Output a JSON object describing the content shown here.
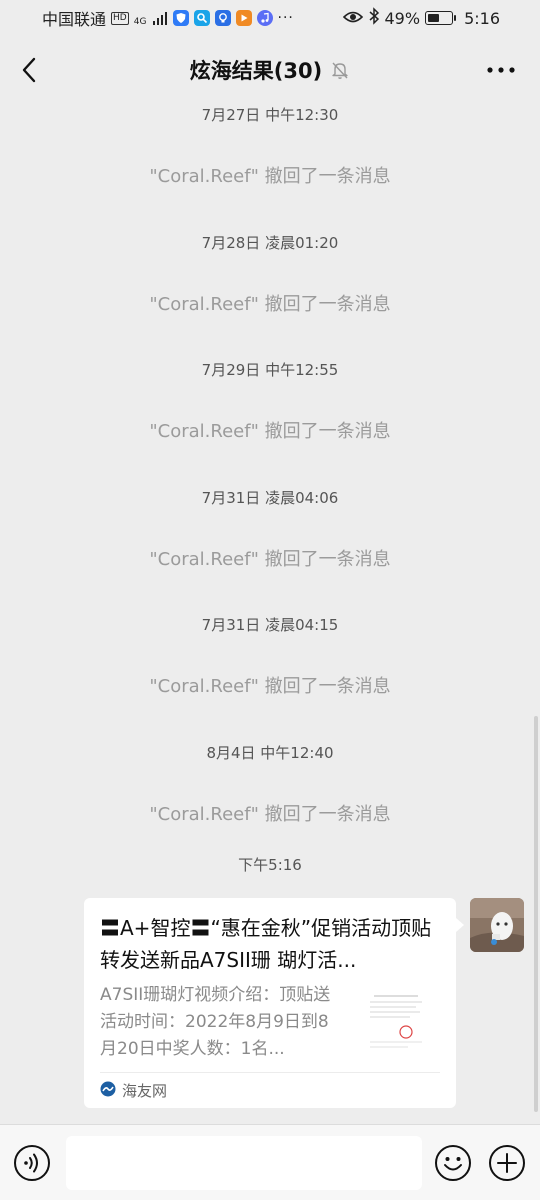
{
  "status_bar": {
    "carrier": "中国联通",
    "hd": "HD",
    "network": "4G",
    "network_sub": "HD",
    "battery": "49%",
    "battery_level": 0.49,
    "time": "5:16"
  },
  "header": {
    "title": "炫海结果(30)"
  },
  "messages": [
    {
      "timestamp": "7月27日 中午12:30",
      "recall": "\"Coral.Reef\" 撤回了一条消息"
    },
    {
      "timestamp": "7月28日 凌晨01:20",
      "recall": "\"Coral.Reef\" 撤回了一条消息"
    },
    {
      "timestamp": "7月29日 中午12:55",
      "recall": "\"Coral.Reef\" 撤回了一条消息"
    },
    {
      "timestamp": "7月31日 凌晨04:06",
      "recall": "\"Coral.Reef\" 撤回了一条消息"
    },
    {
      "timestamp": "7月31日 凌晨04:15",
      "recall": "\"Coral.Reef\" 撤回了一条消息"
    },
    {
      "timestamp": "8月4日 中午12:40",
      "recall": "\"Coral.Reef\" 撤回了一条消息"
    }
  ],
  "last_timestamp": "下午5:16",
  "card": {
    "title": "〓A+智控〓“惠在金秋”促销活动顶贴转发送新品A7SII珊 瑚灯活...",
    "description": "A7SII珊瑚灯视频介绍：顶贴送活动时间：2022年8月9日到8月20日中奖人数：1名...",
    "source": "海友网"
  },
  "input": {
    "value": "",
    "placeholder": ""
  },
  "colors": {
    "background": "#ededed",
    "card": "#ffffff",
    "recall_text": "#9b9b9b"
  }
}
